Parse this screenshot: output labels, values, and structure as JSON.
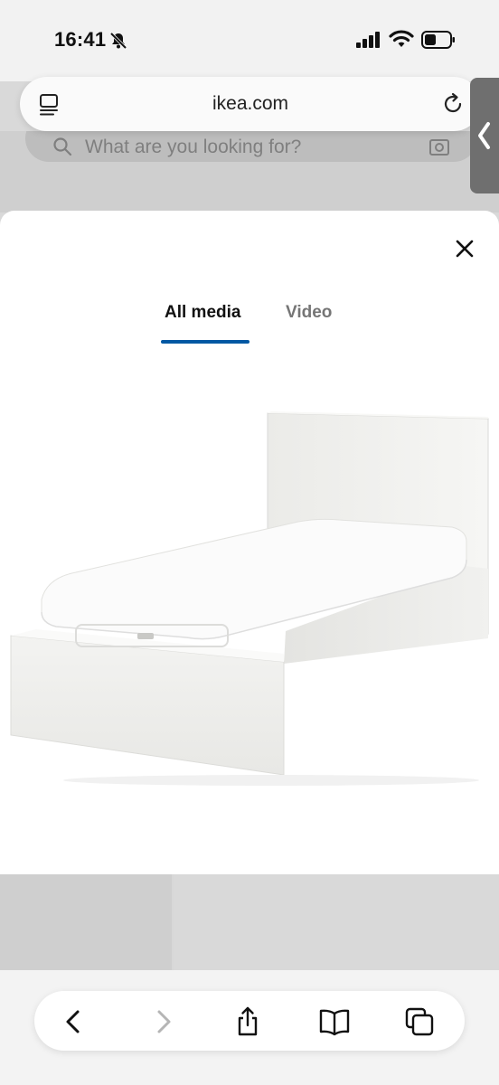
{
  "status_bar": {
    "time": "16:41"
  },
  "browser": {
    "url": "ikea.com"
  },
  "background_page": {
    "search_placeholder": "What are you looking for?"
  },
  "modal": {
    "tabs": [
      {
        "label": "All media",
        "active": true
      },
      {
        "label": "Video",
        "active": false
      }
    ],
    "accent_color": "#0058a3",
    "media_image": "white-single-ottoman-bed-with-mattress"
  },
  "toolbar": {
    "icons": [
      "chevron-left-icon",
      "chevron-right-icon",
      "share-icon",
      "bookmarks-icon",
      "tabs-icon"
    ]
  }
}
